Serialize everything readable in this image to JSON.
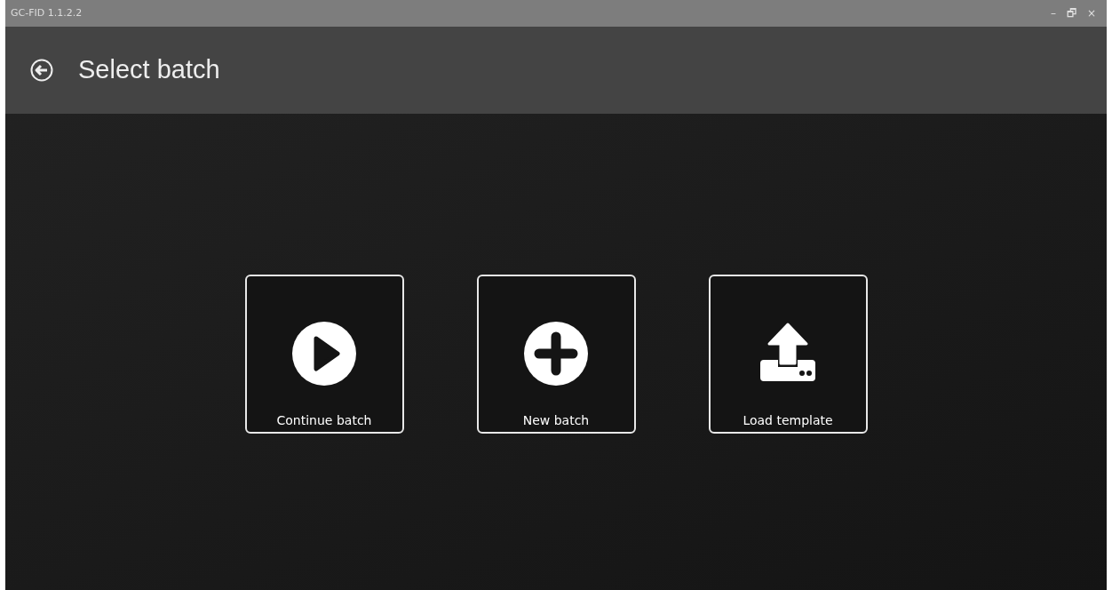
{
  "window": {
    "title": "GC-FID 1.1.2.2",
    "controls": [
      "–",
      "🗗",
      "×"
    ]
  },
  "header": {
    "title": "Select batch"
  },
  "options": [
    {
      "kind": "play",
      "label": "Continue batch"
    },
    {
      "kind": "plus",
      "label": "New batch"
    },
    {
      "kind": "upload",
      "label": "Load template"
    }
  ]
}
